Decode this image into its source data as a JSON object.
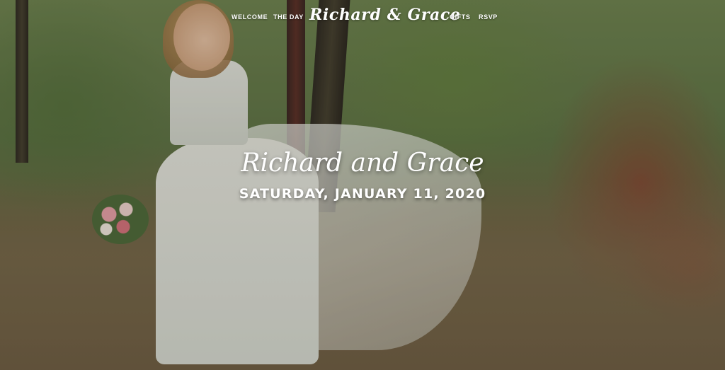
{
  "nav": {
    "left": [
      "WELCOME",
      "THE DAY"
    ],
    "brand": "Richard & Grace",
    "right": [
      "GIFTS",
      "RSVP"
    ]
  },
  "hero": {
    "title": "Richard and Grace",
    "date": "SATURDAY, JANUARY 11, 2020"
  },
  "colors": {
    "text": "#ffffff"
  }
}
